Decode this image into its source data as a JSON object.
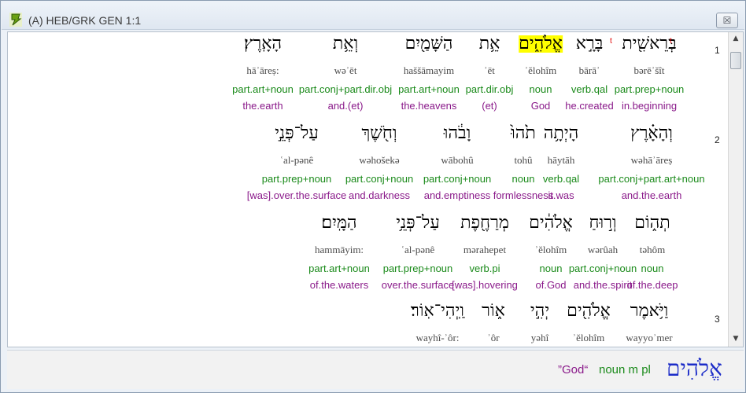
{
  "window": {
    "title": "(A) HEB/GRK GEN 1:1",
    "close_label": "☒"
  },
  "verses": [
    {
      "num": "1",
      "words": [
        {
          "heb": "בְּרֵאשִׁ֖ית",
          "tmark": "t",
          "translit": "bərēʾšît",
          "morph": "part.prep+noun",
          "gloss": "in.beginning"
        },
        {
          "heb": "בָּרָ֣א",
          "tmark": "t",
          "translit": "bārāʾ",
          "morph": "verb.qal",
          "gloss": "he.created"
        },
        {
          "heb": "אֱלֹהִ֑ים",
          "highlight": true,
          "translit": "ʾĕlohîm",
          "morph": "noun",
          "gloss": "God"
        },
        {
          "heb": "אֵ֥ת",
          "translit": "ʾēt",
          "morph": "part.dir.obj",
          "gloss": "(et)"
        },
        {
          "heb": "הַשָּׁמַ֖יִם",
          "translit": "haššāmayim",
          "morph": "part.art+noun",
          "gloss": "the.heavens"
        },
        {
          "heb": "וְאֵ֥ת",
          "translit": "wəʾēt",
          "morph": "part.conj+part.dir.obj",
          "gloss": "and.(et)"
        },
        {
          "heb": "הָאָֽרֶץ׃",
          "translit": "hāʾāreṣ:",
          "morph": "part.art+noun",
          "gloss": "the.earth"
        }
      ]
    },
    {
      "num": "2",
      "words": [
        {
          "heb": "וְהָאָ֗רֶץ",
          "translit": "wəhāʾāreṣ",
          "morph": "part.conj+part.art+noun",
          "gloss": "and.the.earth"
        },
        {
          "heb": "הָיְתָ֥ה",
          "translit": "hāytāh",
          "morph": "verb.qal",
          "gloss": "it.was"
        },
        {
          "heb": "תֹ֙הוּ֙",
          "translit": "tohû",
          "morph": "noun",
          "gloss": "formlessness"
        },
        {
          "heb": "וָבֹ֔הוּ",
          "translit": "wābohû",
          "morph": "part.conj+noun",
          "gloss": "and.emptiness"
        },
        {
          "heb": "וְחֹ֖שֶׁךְ",
          "translit": "wəhošekə",
          "morph": "part.conj+noun",
          "gloss": "and.darkness"
        },
        {
          "heb": "עַל־פְּנֵ֣י",
          "translit": "ʿal-pənê",
          "morph": "part.prep+noun",
          "gloss": "[was].over.the.surface"
        }
      ]
    },
    {
      "num": "",
      "words": [
        {
          "heb": "תְה֑וֹם",
          "translit": "təhôm",
          "morph": "noun",
          "gloss": "of.the.deep"
        },
        {
          "heb": "וְר֣וּחַ",
          "translit": "wərûah",
          "morph": "part.conj+noun",
          "gloss": "and.the.spirit"
        },
        {
          "heb": "אֱלֹהִ֔ים",
          "translit": "ʾĕlohîm",
          "morph": "noun",
          "gloss": "of.God"
        },
        {
          "heb": "מְרַחֶ֖פֶת",
          "translit": "mərahepet",
          "morph": "verb.pi",
          "gloss": "[was].hovering"
        },
        {
          "heb": "עַל־פְּנֵ֥י",
          "translit": "ʿal-pənê",
          "morph": "part.prep+noun",
          "gloss": "over.the.surface"
        },
        {
          "heb": "הַמָּֽיִם׃",
          "translit": "hammāyim:",
          "morph": "part.art+noun",
          "gloss": "of.the.waters"
        }
      ]
    },
    {
      "num": "3",
      "words": [
        {
          "heb": "וַיֹּ֥אמֶר",
          "translit": "wayyoʾmer"
        },
        {
          "heb": "אֱלֹהִ֖ים",
          "translit": "ʾĕlohîm"
        },
        {
          "heb": "יְהִ֣י",
          "translit": "yəhî"
        },
        {
          "heb": "א֑וֹר",
          "translit": "ʾôr"
        },
        {
          "heb": "וַֽיְהִי־אֽוֹר׃",
          "translit": "wayhî-ʾôr:"
        }
      ]
    }
  ],
  "status": {
    "heb": "אֱלֹהִים",
    "gloss": "”God“",
    "morph": "noun m pl"
  },
  "icons": {
    "app": "app-logo-icon",
    "close": "close-icon",
    "scroll_up": "scroll-up-arrow-icon",
    "scroll_down": "scroll-down-arrow-icon"
  },
  "colors": {
    "translit": "#4a4a4a",
    "morph": "#1a8a1a",
    "gloss": "#8a1a8a",
    "highlight": "#ffff00",
    "status_heb": "#1c2cc8",
    "tmark": "#e00000"
  }
}
